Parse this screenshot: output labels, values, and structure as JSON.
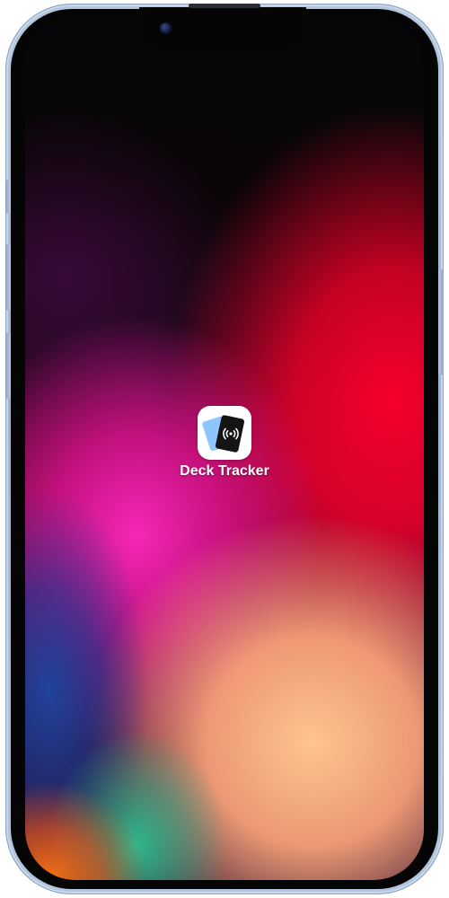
{
  "home_screen": {
    "apps": [
      {
        "label": "Deck Tracker",
        "icon": "deck-tracker-icon"
      }
    ]
  },
  "colors": {
    "device_frame": "#a6bad3",
    "icon_back_card": "#8ec5ff",
    "icon_front_card": "#141414",
    "label_text": "#ffffff"
  }
}
